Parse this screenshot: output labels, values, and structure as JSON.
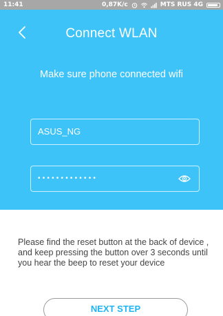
{
  "status_bar": {
    "time": "11:41",
    "speed": "0,87K/c",
    "carrier": "MTS RUS 4G",
    "icons": [
      "alarm-icon",
      "wifi-icon",
      "signal-icon",
      "battery-icon"
    ]
  },
  "header": {
    "title": "Connect WLAN",
    "subtitle": "Make sure phone connected wifi",
    "background_color": "#3dc3f8"
  },
  "form": {
    "ssid_value": "ASUS_NG",
    "password_masked": "•••••••••••••",
    "password_toggle_icon": "eye-icon"
  },
  "instructions": "Please find the reset button at the back of device , and keep pressing the button over 3 seconds until you hear the beep to reset your device",
  "actions": {
    "next_label": "NEXT STEP",
    "accent_color": "#1fb4f2"
  }
}
